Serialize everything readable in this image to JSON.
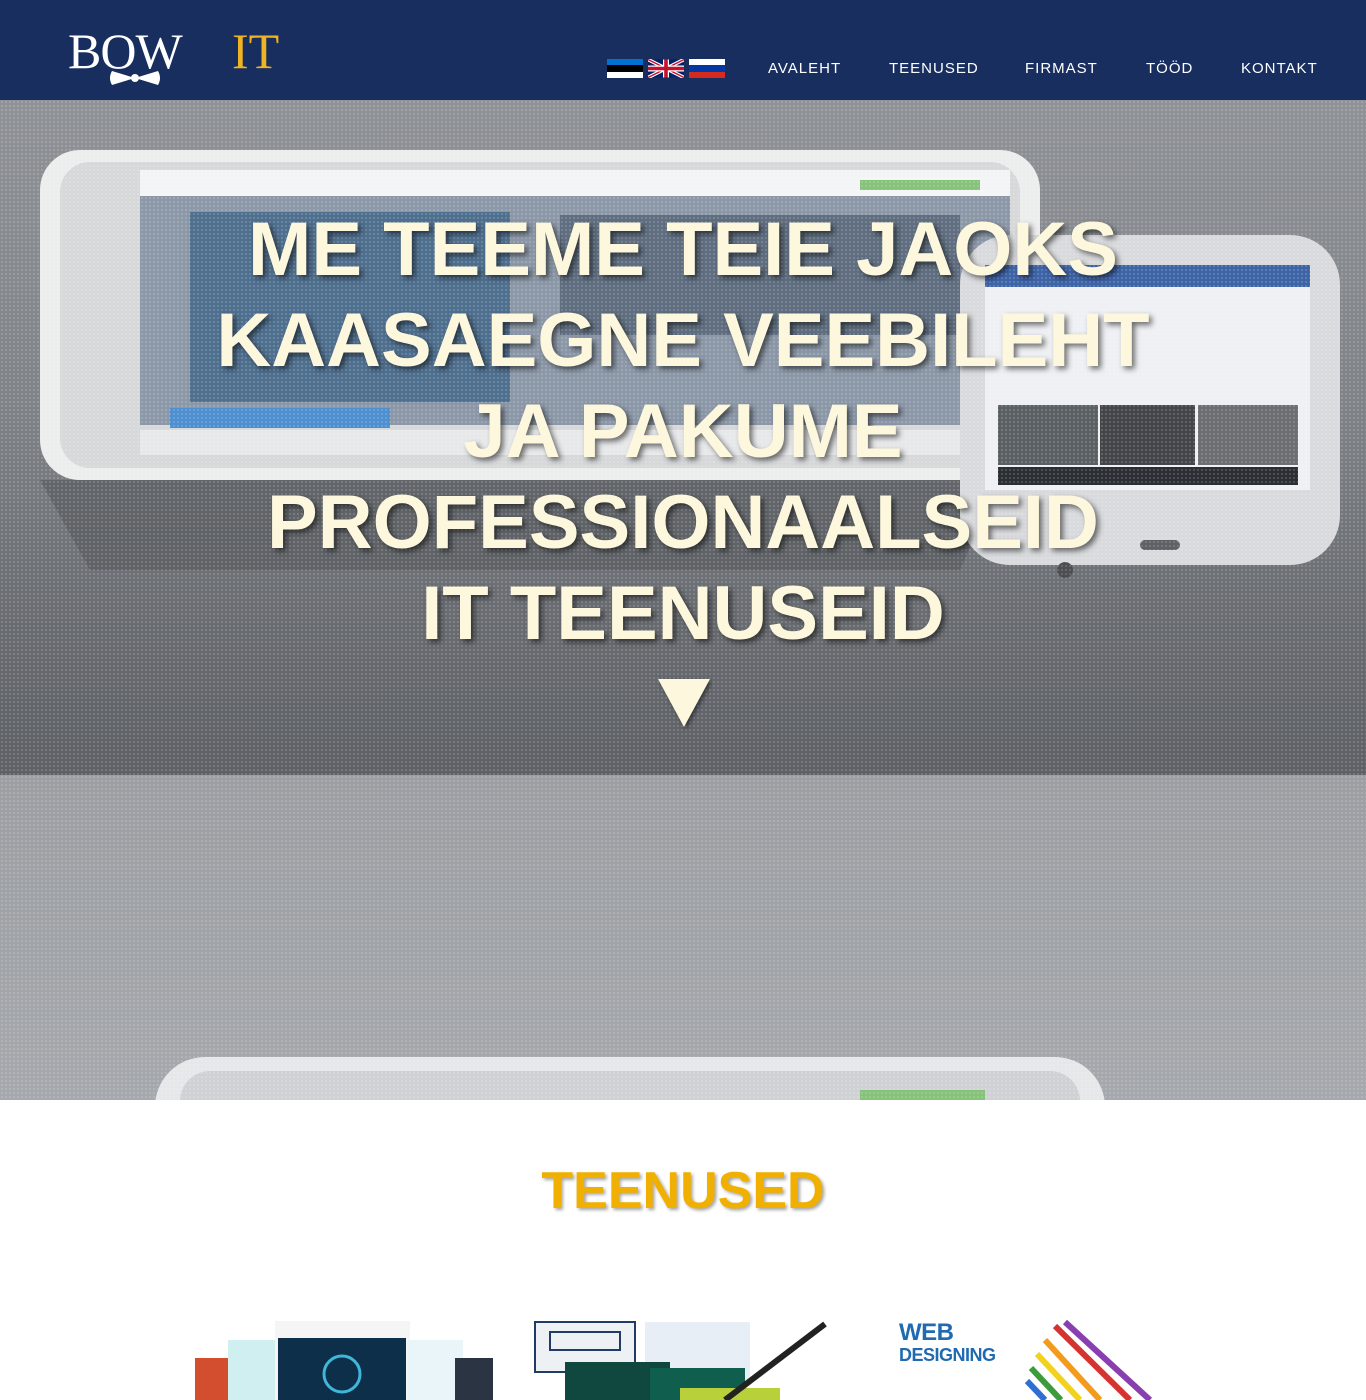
{
  "header": {
    "logo": {
      "word1": "BOW",
      "word2": "IT"
    },
    "flags": [
      {
        "name": "estonian",
        "colors": [
          "#0072ce",
          "#000000",
          "#ffffff"
        ]
      },
      {
        "name": "english",
        "colors": [
          "#012169",
          "#ffffff",
          "#c8102e"
        ]
      },
      {
        "name": "russian",
        "colors": [
          "#ffffff",
          "#0039a6",
          "#d52b1e"
        ]
      }
    ],
    "nav": [
      {
        "label": "AVALEHT"
      },
      {
        "label": "TEENUSED"
      },
      {
        "label": "FIRMAST"
      },
      {
        "label": "TÖÖD"
      },
      {
        "label": "KONTAKT"
      }
    ]
  },
  "hero": {
    "headline_lines": [
      "ME TEEME TEIE JAOKS",
      "KAASAEGNE VEEBILEHT",
      "JA PAKUME",
      "PROFESSIONAALSEID",
      "IT TEENUSEID"
    ],
    "arrow": "▼"
  },
  "services": {
    "title": "TEENUSED",
    "webdesign_line1": "WEB",
    "webdesign_line2": "DESIGNING"
  },
  "colors": {
    "header_bg": "#172e5f",
    "accent": "#f0b323",
    "headline": "#fdf8dd",
    "services_title": "#f1b000"
  }
}
